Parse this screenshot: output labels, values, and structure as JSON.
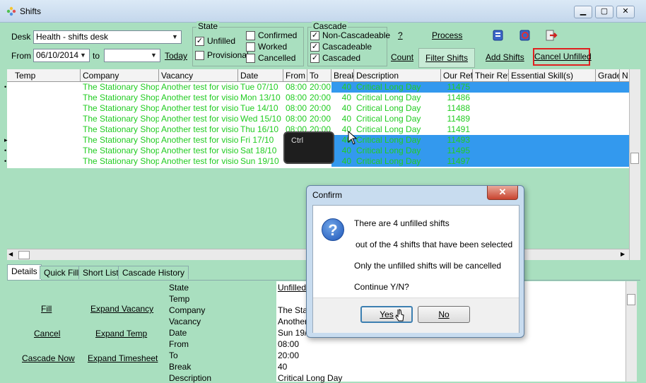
{
  "window": {
    "title": "Shifts"
  },
  "toolbar": {
    "desk_label": "Desk",
    "desk_value": "Health - shifts desk",
    "from_label": "From",
    "from_value": "06/10/2014",
    "to_label": "to",
    "to_value": "",
    "today_link": "Today",
    "state_group": "State",
    "state_options": [
      {
        "label": "Unfilled",
        "checked": true
      },
      {
        "label": "Provisional",
        "checked": false
      },
      {
        "label": "Confirmed",
        "checked": false
      },
      {
        "label": "Worked",
        "checked": false
      },
      {
        "label": "Cancelled",
        "checked": false
      }
    ],
    "cascade_group": "Cascade",
    "cascade_options": [
      {
        "label": "Non-Cascadeable",
        "checked": true
      },
      {
        "label": "Cascadeable",
        "checked": true
      },
      {
        "label": "Cascaded",
        "checked": true
      }
    ],
    "help_link": "?",
    "count_link": "Count",
    "process_link": "Process",
    "filter_button": "Filter Shifts",
    "add_shifts_link": "Add Shifts",
    "cancel_unfilled_link": "Cancel Unfilled"
  },
  "grid": {
    "columns": [
      "Temp",
      "Company",
      "Vacancy",
      "Date",
      "From",
      "To",
      "Break",
      "Description",
      "Our Ref.",
      "Their Ref.",
      "Essential Skill(s)",
      "Grade",
      "N"
    ],
    "rows": [
      {
        "indicator": "•",
        "company": "The Stationary Shop",
        "vacancy": "Another test for vision",
        "date": "Tue 07/10",
        "from": "08:00",
        "to": "20:00",
        "break": "40",
        "description": "Critical Long Day",
        "ref": "11475",
        "selected": true
      },
      {
        "indicator": "",
        "company": "The Stationary Shop",
        "vacancy": "Another test for vision",
        "date": "Mon 13/10",
        "from": "08:00",
        "to": "20:00",
        "break": "40",
        "description": "Critical Long Day",
        "ref": "11486",
        "selected": false
      },
      {
        "indicator": "",
        "company": "The Stationary Shop",
        "vacancy": "Another test for vision",
        "date": "Tue 14/10",
        "from": "08:00",
        "to": "20:00",
        "break": "40",
        "description": "Critical Long Day",
        "ref": "11488",
        "selected": false
      },
      {
        "indicator": "",
        "company": "The Stationary Shop",
        "vacancy": "Another test for vision",
        "date": "Wed 15/10",
        "from": "08:00",
        "to": "20:00",
        "break": "40",
        "description": "Critical Long Day",
        "ref": "11489",
        "selected": false
      },
      {
        "indicator": "",
        "company": "The Stationary Shop",
        "vacancy": "Another test for vision",
        "date": "Thu 16/10",
        "from": "08:00",
        "to": "20:00",
        "break": "40",
        "description": "Critical Long Day",
        "ref": "11491",
        "selected": false
      },
      {
        "indicator": "▸",
        "company": "The Stationary Shop",
        "vacancy": "Another test for vision",
        "date": "Fri 17/10",
        "from": "08:00",
        "to": "20:00",
        "break": "40",
        "description": "Critical Long Day",
        "ref": "11493",
        "selected": true
      },
      {
        "indicator": "•",
        "company": "The Stationary Shop",
        "vacancy": "Another test for vision",
        "date": "Sat 18/10",
        "from": "08:00",
        "to": "20:00",
        "break": "40",
        "description": "Critical Long Day",
        "ref": "11495",
        "selected": true
      },
      {
        "indicator": "•",
        "company": "The Stationary Shop",
        "vacancy": "Another test for vision",
        "date": "Sun 19/10",
        "from": "08:00",
        "to": "20:00",
        "break": "40",
        "description": "Critical Long Day",
        "ref": "11497",
        "selected": true
      }
    ]
  },
  "tabs": [
    "Details",
    "Quick Fill",
    "Short List",
    "Cascade History"
  ],
  "details": {
    "actions": [
      "Fill",
      "Expand Vacancy",
      "Cancel",
      "Expand Temp",
      "Cascade Now",
      "Expand Timesheet"
    ],
    "fields": [
      {
        "label": "State",
        "value": "Unfilled"
      },
      {
        "label": "Temp",
        "value": ""
      },
      {
        "label": "Company",
        "value": "The Sta"
      },
      {
        "label": "Vacancy",
        "value": "Another"
      },
      {
        "label": "Date",
        "value": "Sun 19/"
      },
      {
        "label": "From",
        "value": "08:00"
      },
      {
        "label": "To",
        "value": "20:00"
      },
      {
        "label": "Break",
        "value": "40"
      },
      {
        "label": "Description",
        "value": "Critical Long Day"
      }
    ]
  },
  "dialog": {
    "title": "Confirm",
    "line1": "There are 4 unfilled shifts",
    "line2": "out of the 4 shifts that have been selected",
    "line3": "Only the unfilled shifts will be cancelled",
    "line4": "Continue Y/N?",
    "yes": "Yes",
    "no": "No"
  },
  "overlay": {
    "key_label": "Ctrl"
  },
  "colors": {
    "background": "#a9dfbf",
    "row_text": "#22cc22",
    "selection": "#3399ee",
    "highlight_border": "#e02020"
  }
}
